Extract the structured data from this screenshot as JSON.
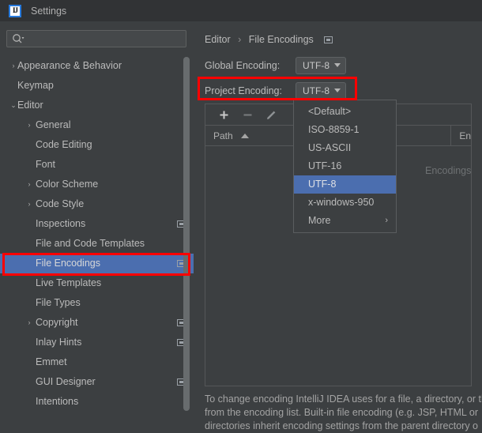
{
  "window": {
    "title": "Settings",
    "app_icon": "intellij-idea-icon",
    "app_icon_text": "IJ"
  },
  "sidebar": {
    "search": {
      "placeholder": "",
      "value": "",
      "icon": "search-icon"
    },
    "items": [
      {
        "label": "Appearance & Behavior",
        "depth": 0,
        "arrow": "›",
        "selected": false,
        "project_icon": false
      },
      {
        "label": "Keymap",
        "depth": 0,
        "arrow": "",
        "selected": false,
        "project_icon": false
      },
      {
        "label": "Editor",
        "depth": 0,
        "arrow": "⌄",
        "expanded": true,
        "selected": false,
        "project_icon": false
      },
      {
        "label": "General",
        "depth": 1,
        "arrow": "›",
        "selected": false,
        "project_icon": false
      },
      {
        "label": "Code Editing",
        "depth": 1,
        "arrow": "",
        "selected": false,
        "project_icon": false
      },
      {
        "label": "Font",
        "depth": 1,
        "arrow": "",
        "selected": false,
        "project_icon": false
      },
      {
        "label": "Color Scheme",
        "depth": 1,
        "arrow": "›",
        "selected": false,
        "project_icon": false
      },
      {
        "label": "Code Style",
        "depth": 1,
        "arrow": "›",
        "selected": false,
        "project_icon": false
      },
      {
        "label": "Inspections",
        "depth": 1,
        "arrow": "",
        "selected": false,
        "project_icon": true
      },
      {
        "label": "File and Code Templates",
        "depth": 1,
        "arrow": "",
        "selected": false,
        "project_icon": false
      },
      {
        "label": "File Encodings",
        "depth": 1,
        "arrow": "",
        "selected": true,
        "project_icon": true
      },
      {
        "label": "Live Templates",
        "depth": 1,
        "arrow": "",
        "selected": false,
        "project_icon": false
      },
      {
        "label": "File Types",
        "depth": 1,
        "arrow": "",
        "selected": false,
        "project_icon": false
      },
      {
        "label": "Copyright",
        "depth": 1,
        "arrow": "›",
        "selected": false,
        "project_icon": true
      },
      {
        "label": "Inlay Hints",
        "depth": 1,
        "arrow": "",
        "selected": false,
        "project_icon": true
      },
      {
        "label": "Emmet",
        "depth": 1,
        "arrow": "",
        "selected": false,
        "project_icon": false
      },
      {
        "label": "GUI Designer",
        "depth": 1,
        "arrow": "",
        "selected": false,
        "project_icon": true
      },
      {
        "label": "Intentions",
        "depth": 1,
        "arrow": "",
        "selected": false,
        "project_icon": false
      }
    ]
  },
  "content": {
    "breadcrumb": {
      "parent": "Editor",
      "separator": "›",
      "current": "File Encodings",
      "project_icon": "project-scope-icon"
    },
    "global_encoding": {
      "label": "Global Encoding:",
      "value": "UTF-8"
    },
    "project_encoding": {
      "label": "Project Encoding:",
      "value": "UTF-8"
    },
    "toolbar": {
      "add_label": "+",
      "remove_label": "−",
      "edit_label": "edit-pencil-icon"
    },
    "table": {
      "columns": [
        "Path",
        "En"
      ],
      "sort_column": "Path",
      "sort_direction": "ascending",
      "rows": [],
      "empty_text": "Encodings are"
    },
    "description": [
      "To change encoding IntelliJ IDEA uses for a file, a directory, or th",
      "from the encoding list. Built-in file encoding (e.g. JSP, HTML or",
      "directories inherit encoding settings from the parent directory o"
    ]
  },
  "dropdown": {
    "open": true,
    "items": [
      {
        "label": "<Default>",
        "selected": false,
        "submenu": false
      },
      {
        "label": "ISO-8859-1",
        "selected": false,
        "submenu": false
      },
      {
        "label": "US-ASCII",
        "selected": false,
        "submenu": false
      },
      {
        "label": "UTF-16",
        "selected": false,
        "submenu": false
      },
      {
        "label": "UTF-8",
        "selected": true,
        "submenu": false
      },
      {
        "label": "x-windows-950",
        "selected": false,
        "submenu": false
      },
      {
        "label": "More",
        "selected": false,
        "submenu": true,
        "submenu_arrow": "›"
      }
    ]
  },
  "annotations": {
    "sidebar_highlight": "File Encodings",
    "project_encoding_highlight": "Project Encoding: UTF-8",
    "color": "#ff0000"
  }
}
